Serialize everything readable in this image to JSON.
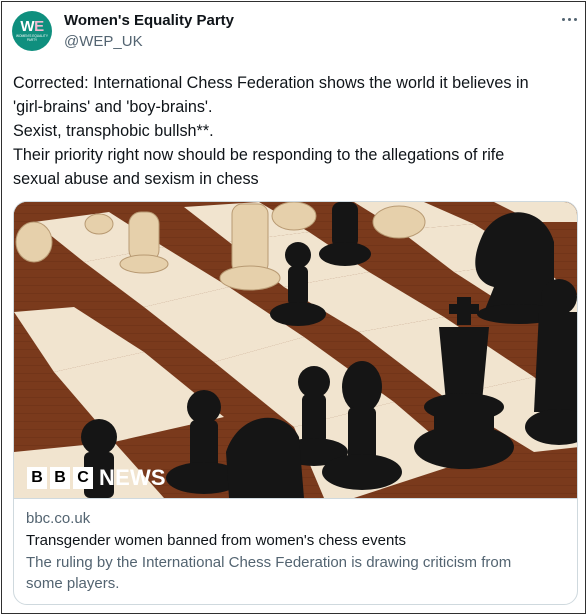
{
  "tweet": {
    "author_name": "Women's Equality Party",
    "author_handle": "@WEP_UK",
    "avatar": {
      "monogram_w": "W",
      "monogram_e": "E",
      "tagline": "WOMEN'S EQUALITY PARTY"
    },
    "more_icon": "more-horizontal-icon",
    "text_lines": [
      "Corrected: International Chess Federation shows the world it believes in",
      "'girl-brains' and 'boy-brains'.",
      "Sexist, transphobic bullsh**.",
      "Their priority right now should be responding to the allegations of rife",
      "sexual abuse and sexism in chess"
    ]
  },
  "card": {
    "image_badge": {
      "b1": "B",
      "b2": "B",
      "b3": "C",
      "news": "NEWS"
    },
    "domain": "bbc.co.uk",
    "title": "Transgender women banned from women's chess events",
    "description_lines": [
      "The ruling by the International Chess Federation is drawing criticism from",
      "some players."
    ]
  },
  "colors": {
    "avatar_bg": "#0f8f7e",
    "text_primary": "#0f1419",
    "text_secondary": "#536471",
    "card_border": "#cfd9de"
  }
}
